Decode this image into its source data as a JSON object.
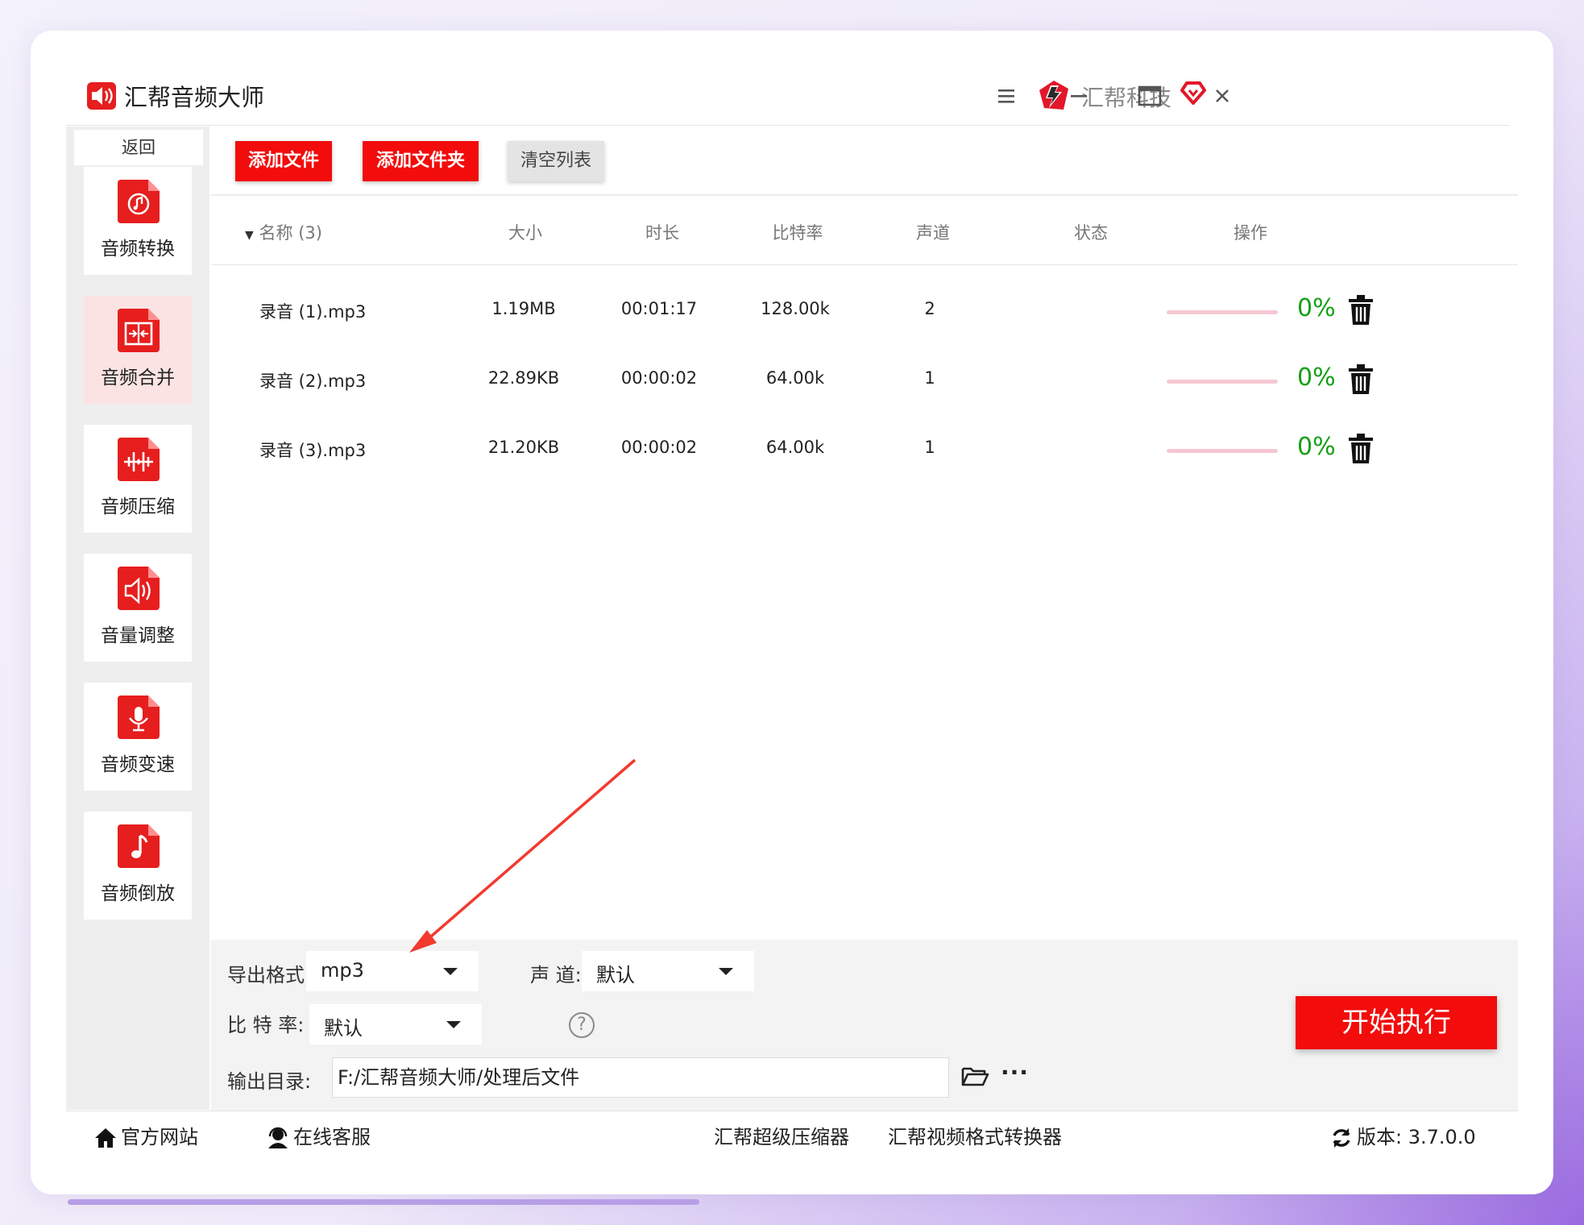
{
  "app": {
    "title": "汇帮音频大师",
    "brand": "汇帮科技",
    "accent_color": "#f20c0c",
    "window_controls": [
      "menu-icon",
      "minimize-icon",
      "maximize-icon",
      "close-icon"
    ]
  },
  "sidebar": {
    "back_label": "返回",
    "items": [
      {
        "label": "音频转换",
        "icon": "audio-convert-icon",
        "active": false
      },
      {
        "label": "音频合并",
        "icon": "audio-merge-icon",
        "active": true
      },
      {
        "label": "音频压缩",
        "icon": "audio-compress-icon",
        "active": false
      },
      {
        "label": "音量调整",
        "icon": "volume-icon",
        "active": false
      },
      {
        "label": "音频变速",
        "icon": "microphone-icon",
        "active": false
      },
      {
        "label": "音频倒放",
        "icon": "music-note-icon",
        "active": false
      }
    ]
  },
  "toolbar": {
    "add_file": "添加文件",
    "add_folder": "添加文件夹",
    "clear_list": "清空列表"
  },
  "table": {
    "columns": {
      "name": "名称 (3)",
      "size": "大小",
      "duration": "时长",
      "bitrate": "比特率",
      "channel": "声道",
      "status": "状态",
      "action": "操作"
    },
    "rows": [
      {
        "name": "录音 (1).mp3",
        "size": "1.19MB",
        "duration": "00:01:17",
        "bitrate": "128.00k",
        "channel": "2",
        "progress": 0,
        "status": "0%"
      },
      {
        "name": "录音 (2).mp3",
        "size": "22.89KB",
        "duration": "00:00:02",
        "bitrate": "64.00k",
        "channel": "1",
        "progress": 0,
        "status": "0%"
      },
      {
        "name": "录音 (3).mp3",
        "size": "21.20KB",
        "duration": "00:00:02",
        "bitrate": "64.00k",
        "channel": "1",
        "progress": 0,
        "status": "0%"
      }
    ]
  },
  "settings": {
    "format_label": "导出格式:",
    "format_value": "mp3",
    "channel_label": "声 道:",
    "channel_value": "默认",
    "bitrate_label": "比 特 率:",
    "bitrate_value": "默认",
    "help": "?",
    "dir_label": "输出目录:",
    "dir_value": "F:/汇帮音频大师/处理后文件",
    "more": "···",
    "start": "开始执行"
  },
  "footer": {
    "website": "官方网站",
    "support": "在线客服",
    "compressor": "汇帮超级压缩器",
    "video_converter": "汇帮视频格式转换器",
    "version": "版本:  3.7.0.0"
  }
}
